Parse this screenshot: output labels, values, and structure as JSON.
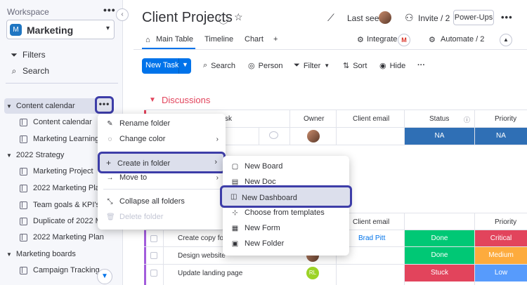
{
  "sidebar": {
    "workspace_label": "Workspace",
    "workspace_name": "Marketing",
    "workspace_initial": "M",
    "filters_label": "Filters",
    "search_label": "Search",
    "folders": [
      {
        "label": "Content calendar"
      },
      {
        "label": "2022 Strategy"
      },
      {
        "label": "Marketing boards"
      }
    ],
    "boards": [
      "Content calendar",
      "Marketing Learning Ce",
      "Marketing Project",
      "2022 Marketing Plan",
      "Team goals & KPI's",
      "Duplicate of 2022 Ma",
      "2022 Marketing Plan",
      "Campaign Tracking"
    ]
  },
  "header": {
    "title": "Client Projects",
    "last_seen_label": "Last seen",
    "invite_label": "Invite / 2",
    "powerups_label": "Power-Ups",
    "tabs": [
      "Main Table",
      "Timeline",
      "Chart",
      "+"
    ],
    "integrate_label": "Integrate",
    "automate_label": "Automate / 2"
  },
  "toolbar": {
    "new_task_label": "New Task",
    "search_label": "Search",
    "person_label": "Person",
    "filter_label": "Filter",
    "sort_label": "Sort",
    "hide_label": "Hide",
    "more_label": "···"
  },
  "board": {
    "group1_title": "Discussions",
    "group1_header_task": "sk",
    "columns": {
      "owner": "Owner",
      "client_email": "Client email",
      "status": "Status",
      "priority": "Priority"
    },
    "group1_row": {
      "status": "NA",
      "priority": "NA"
    },
    "group2_columns": {
      "client_email": "Client email",
      "priority": "Priority"
    },
    "rows": [
      {
        "name": "Create copy fo",
        "email": "Brad Pitt",
        "status": "Done",
        "priority": "Critical"
      },
      {
        "name": "Design website",
        "email": "",
        "status": "Done",
        "priority": "Medium"
      },
      {
        "name": "Update landing page",
        "email": "",
        "status": "Stuck",
        "priority": "Low",
        "owner_initials": "RL"
      }
    ]
  },
  "folder_menu": {
    "items": [
      "Rename folder",
      "Change color",
      "Create in folder",
      "Move to",
      "Collapse all folders",
      "Delete folder"
    ]
  },
  "submenu": {
    "items": [
      "New Board",
      "New Doc",
      "New Dashboard",
      "Choose from templates",
      "New Form",
      "New Folder"
    ]
  },
  "colors": {
    "primary": "#0073ea",
    "done": "#00c875",
    "stuck": "#e2445c",
    "critical": "#e2445c",
    "medium": "#fdab3d",
    "low": "#579bfc",
    "na_status": "#2f6fb5",
    "highlight": "#3d3da8"
  }
}
